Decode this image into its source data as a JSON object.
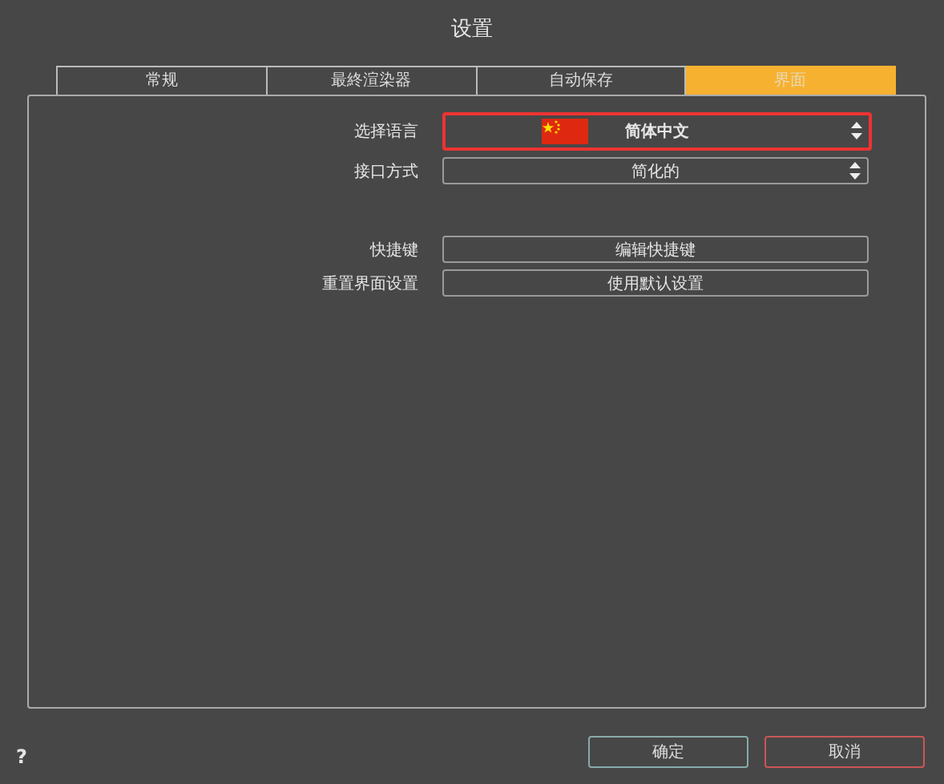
{
  "window": {
    "title": "设置"
  },
  "tabs": [
    {
      "label": "常规",
      "selected": false
    },
    {
      "label": "最終渲染器",
      "selected": false
    },
    {
      "label": "自动保存",
      "selected": false
    },
    {
      "label": "界面",
      "selected": true
    }
  ],
  "settings": [
    {
      "kind": "select",
      "label": "选择语言",
      "value": "简体中文",
      "flag": true,
      "highlighted": true
    },
    {
      "kind": "select",
      "label": "接口方式",
      "value": "简化的",
      "flag": false,
      "highlighted": false
    },
    {
      "kind": "spacer"
    },
    {
      "kind": "button",
      "label": "快捷键",
      "value": "编辑快捷键"
    },
    {
      "kind": "button",
      "label": "重置界面设置",
      "value": "使用默认设置"
    }
  ],
  "help": "?",
  "buttons": [
    {
      "label": "确定",
      "kind": "ok"
    },
    {
      "label": "取消",
      "kind": "cancel"
    }
  ]
}
